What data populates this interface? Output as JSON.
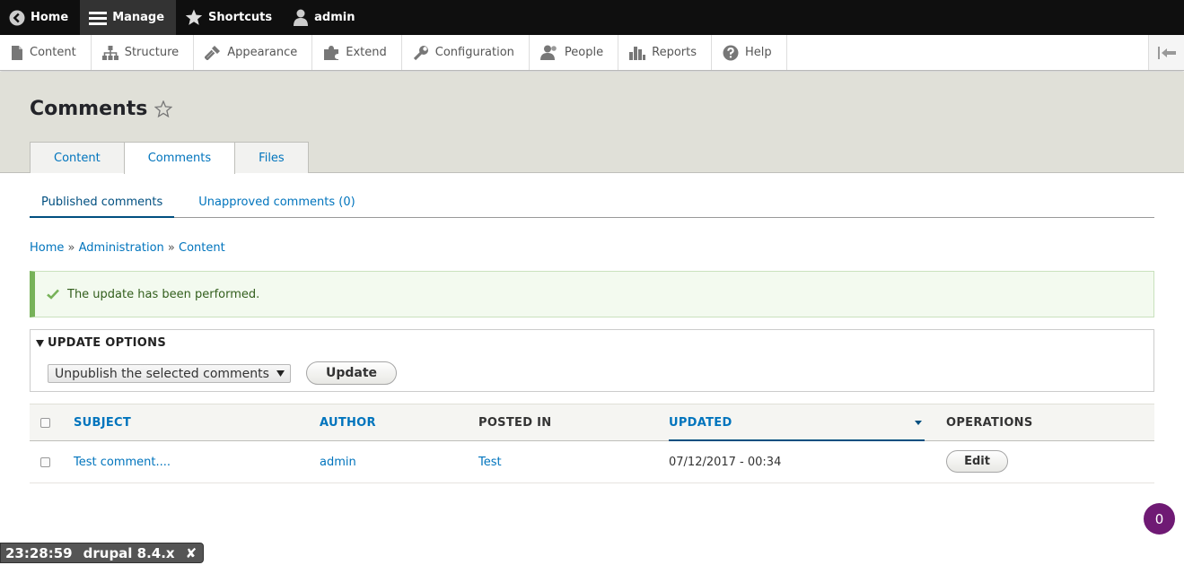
{
  "toolbar": {
    "home": "Home",
    "manage": "Manage",
    "shortcuts": "Shortcuts",
    "user": "admin"
  },
  "tray": {
    "items": [
      "Content",
      "Structure",
      "Appearance",
      "Extend",
      "Configuration",
      "People",
      "Reports",
      "Help"
    ]
  },
  "page": {
    "title": "Comments",
    "tabs": [
      "Content",
      "Comments",
      "Files"
    ],
    "subtabs": [
      "Published comments",
      "Unapproved comments (0)"
    ]
  },
  "breadcrumb": {
    "items": [
      "Home",
      "Administration",
      "Content"
    ],
    "separator": "»"
  },
  "message": {
    "text": "The update has been performed."
  },
  "update_options": {
    "summary": "UPDATE OPTIONS",
    "selected_action": "Unpublish the selected comments",
    "button": "Update"
  },
  "table": {
    "headers": [
      "SUBJECT",
      "AUTHOR",
      "POSTED IN",
      "UPDATED",
      "OPERATIONS"
    ],
    "rows": [
      {
        "subject": "Test comment....",
        "author": "admin",
        "posted_in": "Test",
        "updated": "07/12/2017 - 00:34",
        "operation": "Edit"
      }
    ]
  },
  "badge": {
    "count": "0"
  },
  "env_bar": {
    "time": "23:28:59",
    "site": "drupal 8.4.x",
    "close": "✘"
  },
  "colors": {
    "link": "#0074bd",
    "toolbar": "#0f0f0f",
    "success": "#77b259",
    "badge": "#6f1a74"
  }
}
